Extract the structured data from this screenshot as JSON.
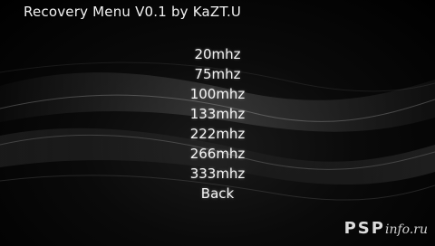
{
  "header": {
    "title": "Recovery Menu V0.1 by KaZT.U"
  },
  "menu": {
    "items": [
      {
        "label": "20mhz"
      },
      {
        "label": "75mhz"
      },
      {
        "label": "100mhz"
      },
      {
        "label": "133mhz"
      },
      {
        "label": "222mhz"
      },
      {
        "label": "266mhz"
      },
      {
        "label": "333mhz"
      },
      {
        "label": "Back"
      }
    ]
  },
  "watermark": {
    "brand": "PSP",
    "domain": "info.ru"
  },
  "colors": {
    "background": "#000000",
    "text": "#f5f5f5",
    "wave": "#ffffff"
  }
}
